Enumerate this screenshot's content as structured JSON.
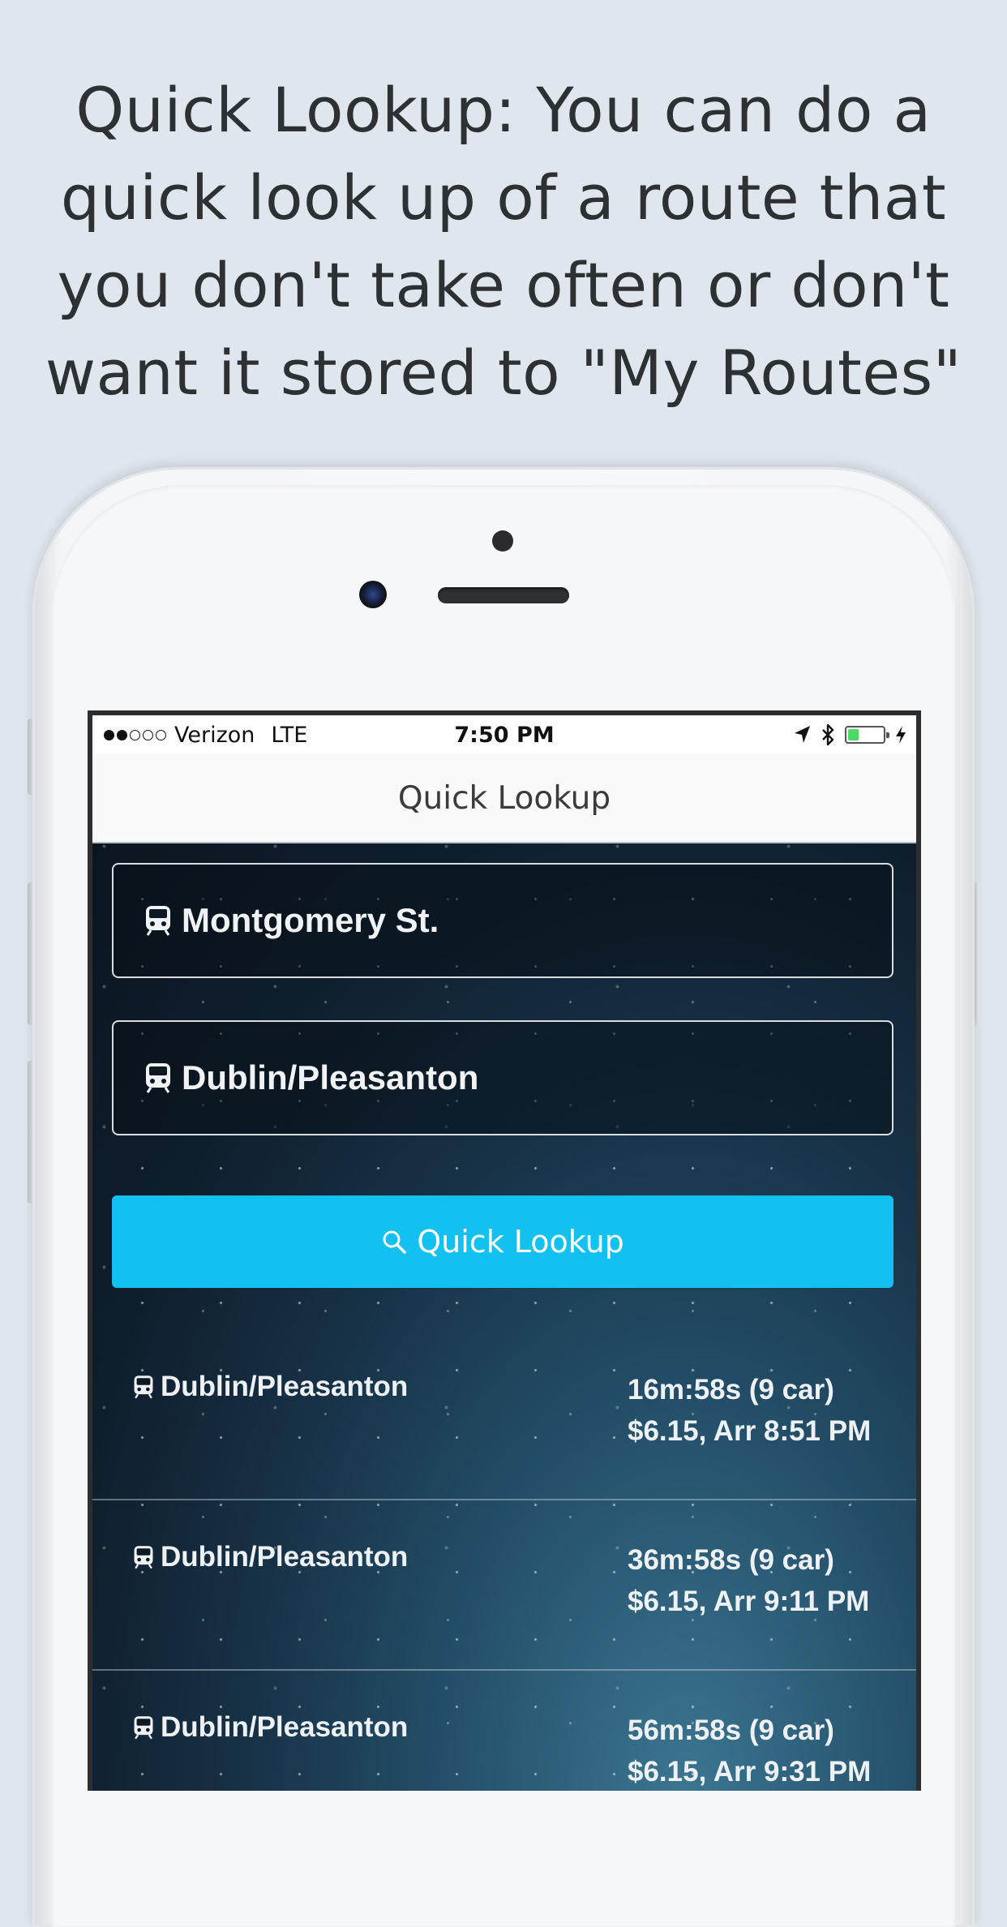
{
  "headline": "Quick Lookup: You can do a quick look up of a route that you don't take often or don't want it stored to \"My Routes\"",
  "status_bar": {
    "carrier": "Verizon",
    "network": "LTE",
    "time": "7:50 PM",
    "signal_bars_filled": 2,
    "signal_bars_total": 5,
    "battery_fraction": 0.3
  },
  "nav": {
    "title": "Quick Lookup"
  },
  "form": {
    "origin": "Montgomery St.",
    "destination": "Dublin/Pleasanton",
    "button_label": "Quick Lookup"
  },
  "results": [
    {
      "destination": "Dublin/Pleasanton",
      "duration": "16m:58s (9 car)",
      "fare_arrival": "$6.15, Arr 8:51 PM"
    },
    {
      "destination": "Dublin/Pleasanton",
      "duration": "36m:58s (9 car)",
      "fare_arrival": "$6.15, Arr 9:11 PM"
    },
    {
      "destination": "Dublin/Pleasanton",
      "duration": "56m:58s (9 car)",
      "fare_arrival": "$6.15, Arr 9:31 PM"
    }
  ],
  "colors": {
    "button": "#13c1f1",
    "background": "#dfe7ec",
    "battery": "#4cd964"
  }
}
